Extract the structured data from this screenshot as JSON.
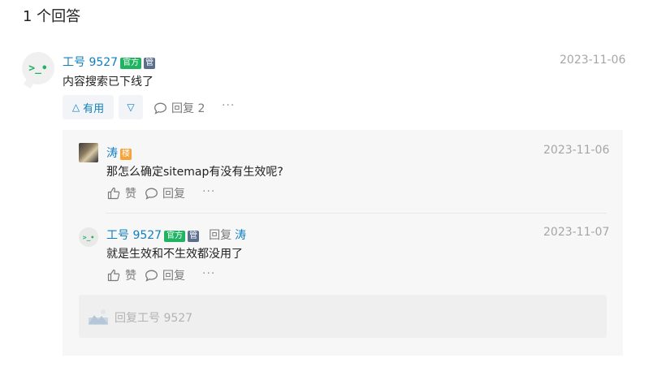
{
  "answers_header": "1 个回答",
  "answer": {
    "author": "工号 9527",
    "badge_official": "官方",
    "badge_staff": "管",
    "date": "2023-11-06",
    "content": "内容搜索已下线了",
    "upvote_label": "有用",
    "reply_count_label": "回复 2",
    "more": "···"
  },
  "comments": [
    {
      "author": "涛",
      "badge_op": "楼",
      "date": "2023-11-06",
      "content": "那怎么确定sitemap有没有生效呢?",
      "like_label": "赞",
      "reply_label": "回复",
      "more": "···"
    },
    {
      "author": "工号 9527",
      "badge_official": "官方",
      "badge_staff": "管",
      "reply_to_label": "回复",
      "reply_to_user": "涛",
      "date": "2023-11-07",
      "content": "就是生效和不生效都没用了",
      "like_label": "赞",
      "reply_label": "回复",
      "more": "···"
    }
  ],
  "reply_box": {
    "placeholder": "回复工号 9527"
  },
  "colors": {
    "link_blue": "#0e7fbf",
    "official_green": "#20b361",
    "staff_badge": "#5b6f8d",
    "op_badge": "#f6a33a"
  }
}
